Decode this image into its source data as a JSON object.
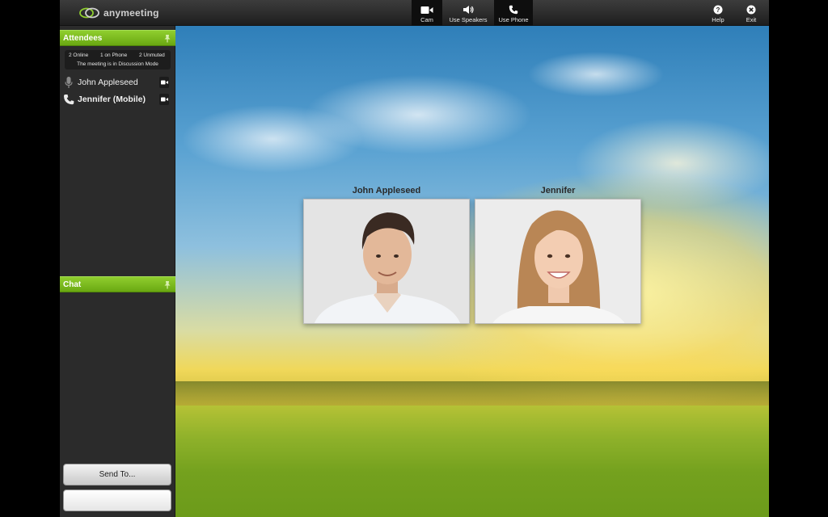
{
  "app": {
    "logo_text": "anymeeting"
  },
  "toolbar": {
    "cam_label": "Cam",
    "speakers_label": "Use Speakers",
    "phone_label": "Use Phone",
    "help_label": "Help",
    "exit_label": "Exit"
  },
  "attendees_panel": {
    "title": "Attendees",
    "online": "2 Online",
    "on_phone": "1 on Phone",
    "unmuted": "2 Unmuted",
    "mode": "The meeting is in Discussion Mode",
    "list": [
      {
        "name": "John Appleseed",
        "icon": "microphone-icon"
      },
      {
        "name": "Jennifer (Mobile)",
        "icon": "phone-icon"
      }
    ]
  },
  "chat_panel": {
    "title": "Chat",
    "send_to_label": "Send To...",
    "input_value": ""
  },
  "video_tiles": [
    {
      "name": "John Appleseed"
    },
    {
      "name": "Jennifer"
    }
  ],
  "colors": {
    "accent_green": "#7cbd1f",
    "topbar": "#2a2a2a"
  }
}
